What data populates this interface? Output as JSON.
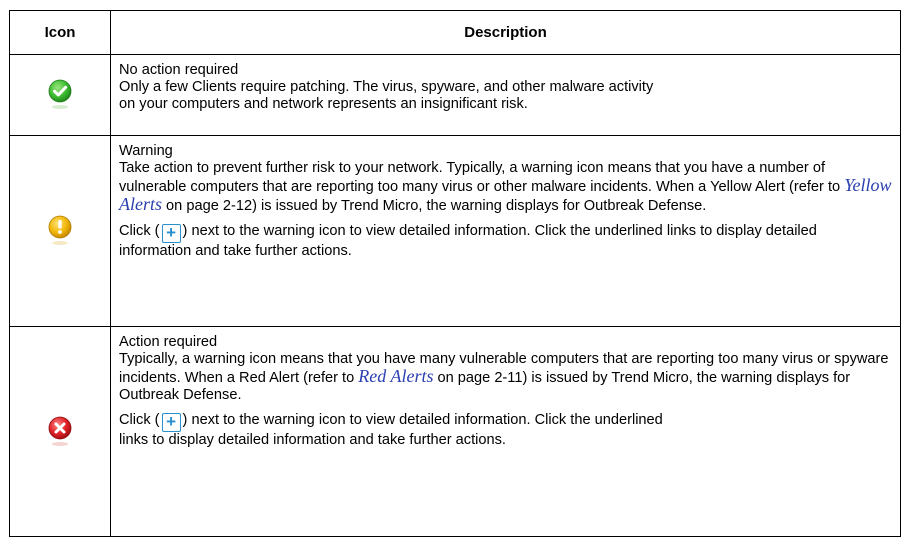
{
  "table": {
    "header_icon": "Icon",
    "header_description": "Description",
    "rows": [
      {
        "icon": "green-check-icon",
        "title": "No action required",
        "line1": "Only a few Clients require patching. The virus, spyware, and other malware activity",
        "line2": "on your computers and network represents an insignificant risk."
      },
      {
        "icon": "yellow-warning-icon",
        "title": "Warning",
        "text_before_link": "Take action to prevent further risk to your network. Typically, a warning icon means that you have a number of vulnerable computers that are reporting too many virus or other malware incidents. When a Yellow Alert (refer to ",
        "link": "Yellow Alerts",
        "text_after_link": " on page 2-12) is issued by Trend Micro, the warning displays for Outbreak Defense.",
        "click_open": "Click (",
        "plus_symbol": "+",
        "click_rest": ") next to the warning icon to view detailed information. Click the underlined links to display detailed information and take further actions."
      },
      {
        "icon": "red-error-icon",
        "title": "Action required",
        "text_before_link": "Typically, a warning icon means that you have many vulnerable computers that are reporting too many virus or spyware incidents. When a Red Alert (refer to ",
        "link": "Red Alerts",
        "text_after_link": " on page 2-11) is issued by Trend Micro, the warning displays for Outbreak Defense.",
        "click_open": "Click (",
        "plus_symbol": "+",
        "click_rest": ") next to the warning icon to view detailed information. Click the underlined",
        "click_last": "links to display detailed information and take further actions."
      }
    ]
  },
  "colors": {
    "green": "#3fbf35",
    "yellow": "#f2b90b",
    "red": "#e0242a",
    "link": "#2a3fb0",
    "plus_box": "#2a8fcf"
  }
}
